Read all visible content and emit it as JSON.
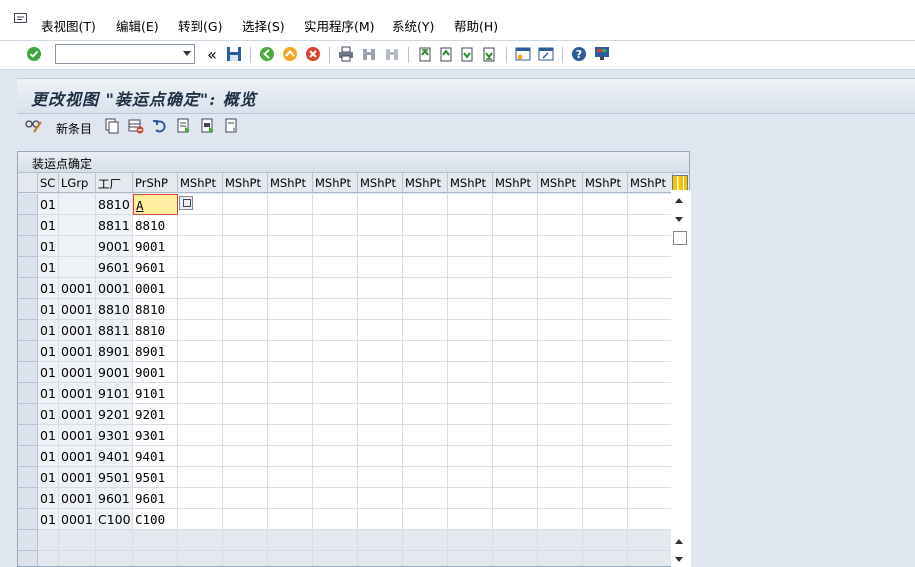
{
  "menu": {
    "items": [
      "表视图(T)",
      "编辑(E)",
      "转到(G)",
      "选择(S)",
      "实用程序(M)",
      "系统(Y)",
      "帮助(H)"
    ]
  },
  "toolbar": {
    "command_field_value": "",
    "history_glyph": "«"
  },
  "page": {
    "title": "更改视图 \"装运点确定\": 概览"
  },
  "app_toolbar": {
    "new_entries_label": "新条目"
  },
  "table": {
    "title": "装运点确定",
    "columns": [
      "SC",
      "LGrp",
      "工厂",
      "PrShP",
      "MShPt",
      "MShPt",
      "MShPt",
      "MShPt",
      "MShPt",
      "MShPt",
      "MShPt",
      "MShPt",
      "MShPt",
      "MShPt",
      "MShPt"
    ],
    "rows": [
      [
        "01",
        "",
        "8810",
        "A"
      ],
      [
        "01",
        "",
        "8811",
        "8810"
      ],
      [
        "01",
        "",
        "9001",
        "9001"
      ],
      [
        "01",
        "",
        "9601",
        "9601"
      ],
      [
        "01",
        "0001",
        "0001",
        "0001"
      ],
      [
        "01",
        "0001",
        "8810",
        "8810"
      ],
      [
        "01",
        "0001",
        "8811",
        "8810"
      ],
      [
        "01",
        "0001",
        "8901",
        "8901"
      ],
      [
        "01",
        "0001",
        "9001",
        "9001"
      ],
      [
        "01",
        "0001",
        "9101",
        "9101"
      ],
      [
        "01",
        "0001",
        "9201",
        "9201"
      ],
      [
        "01",
        "0001",
        "9301",
        "9301"
      ],
      [
        "01",
        "0001",
        "9401",
        "9401"
      ],
      [
        "01",
        "0001",
        "9501",
        "9501"
      ],
      [
        "01",
        "0001",
        "9601",
        "9601"
      ],
      [
        "01",
        "0001",
        "C100",
        "C100"
      ]
    ]
  },
  "colors": {
    "accent_yellow": "#ffef9f",
    "header_bg": "#e4e9ef",
    "title_text": "#1f2f44"
  }
}
